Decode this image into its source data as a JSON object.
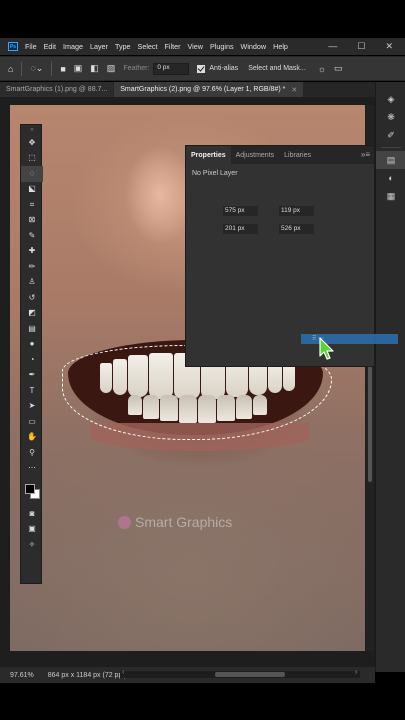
{
  "menubar": {
    "app_icon": "Ps",
    "items": [
      "File",
      "Edit",
      "Image",
      "Layer",
      "Type",
      "Select",
      "Filter",
      "View",
      "Plugins",
      "Window",
      "Help"
    ],
    "minimize": "—",
    "maximize": "☐",
    "close": "✕"
  },
  "options": {
    "feather_label": "Feather:",
    "feather_value": "0 px",
    "antialias_label": "Anti-alias",
    "antialias_checked": true,
    "select_mask_label": "Select and Mask..."
  },
  "tabs": [
    {
      "label": "SmartGraphics (1).png @ 88.7...",
      "active": false
    },
    {
      "label": "SmartGraphics (2).png @ 97.6% (Layer 1, RGB/8#) *",
      "active": true
    }
  ],
  "properties": {
    "tabs": [
      "Properties",
      "Adjustments",
      "Libraries"
    ],
    "title": "No Pixel Layer",
    "w": "575 px",
    "h": "119 px",
    "x": "201 px",
    "y": "526 px"
  },
  "watermark": "Smart Graphics",
  "status": {
    "zoom": "97.61%",
    "doc_size": "864 px x 1184 px (72 ppi)",
    "arrow": "›"
  },
  "icons": {
    "tools": [
      "move-icon",
      "marquee-icon",
      "lasso-icon",
      "object-select-icon",
      "crop-icon",
      "frame-icon",
      "eyedropper-icon",
      "healing-icon",
      "brush-icon",
      "stamp-icon",
      "history-brush-icon",
      "eraser-icon",
      "gradient-icon",
      "blur-icon",
      "dodge-icon",
      "pen-icon",
      "type-icon",
      "path-select-icon",
      "rectangle-icon",
      "hand-icon",
      "zoom-icon",
      "more-icon"
    ]
  }
}
